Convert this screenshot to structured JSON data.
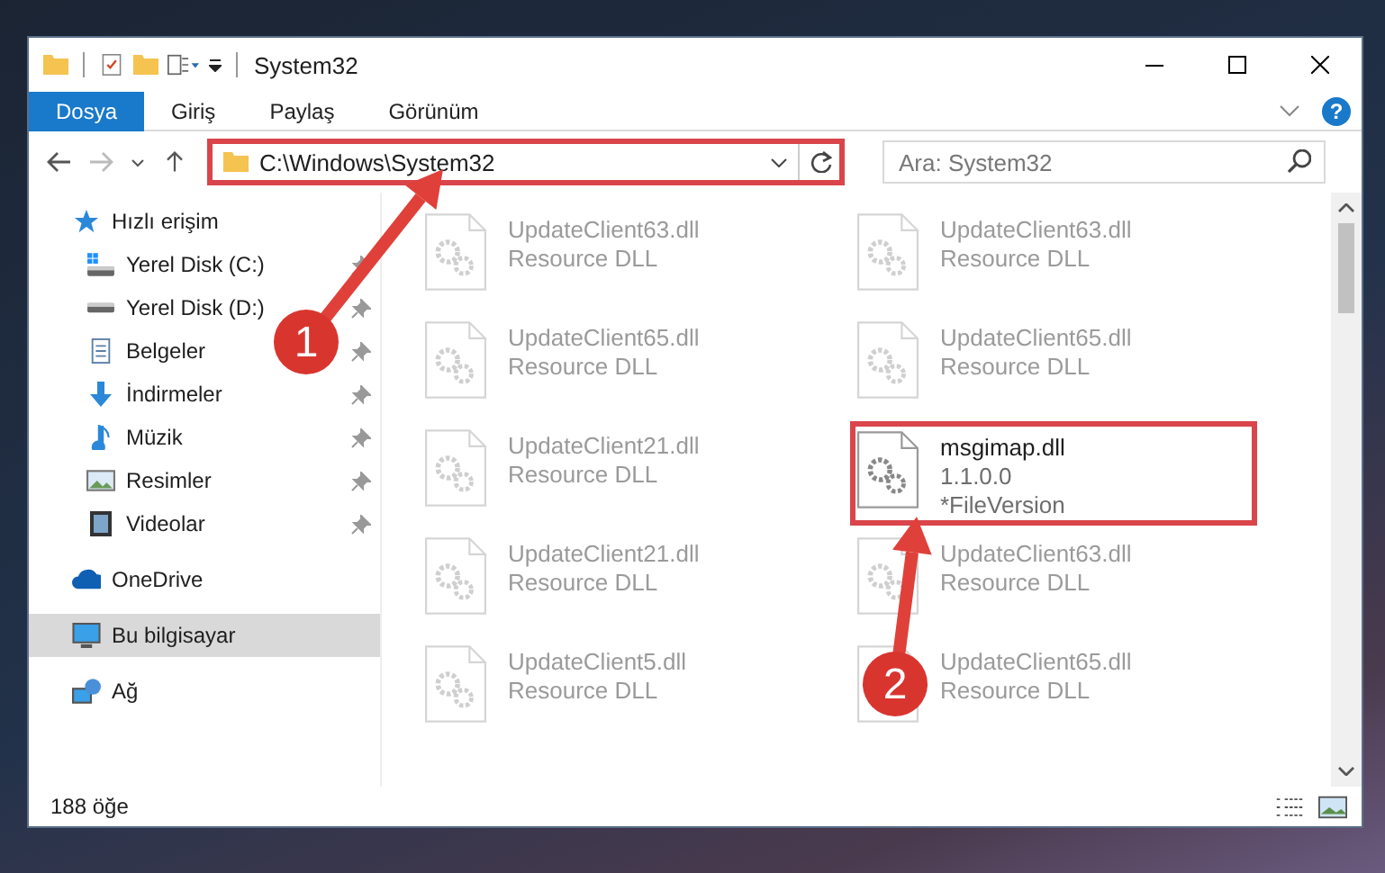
{
  "window": {
    "title": "System32"
  },
  "ribbon_tabs": [
    {
      "label": "Dosya",
      "selected": true
    },
    {
      "label": "Giriş",
      "selected": false
    },
    {
      "label": "Paylaş",
      "selected": false
    },
    {
      "label": "Görünüm",
      "selected": false
    }
  ],
  "help_button": {
    "label": "?"
  },
  "address_bar": {
    "path": "C:\\Windows\\System32",
    "highlighted": true
  },
  "search": {
    "placeholder": "Ara: System32"
  },
  "sidebar": {
    "items": [
      {
        "label": "Hızlı erişim",
        "selected": false,
        "children": [
          {
            "label": "Yerel Disk (C:)",
            "pinned": true,
            "selected": false
          },
          {
            "label": "Yerel Disk (D:)",
            "pinned": true,
            "selected": false
          },
          {
            "label": "Belgeler",
            "pinned": true,
            "selected": false
          },
          {
            "label": "İndirmeler",
            "pinned": true,
            "selected": false
          },
          {
            "label": "Müzik",
            "pinned": true,
            "selected": false
          },
          {
            "label": "Resimler",
            "pinned": true,
            "selected": false
          },
          {
            "label": "Videolar",
            "pinned": true,
            "selected": false
          }
        ]
      },
      {
        "label": "OneDrive",
        "selected": false
      },
      {
        "label": "Bu bilgisayar",
        "selected": true
      },
      {
        "label": "Ağ",
        "selected": false
      }
    ]
  },
  "files": [
    {
      "name": "UpdateClient63.dll",
      "line_2": "Resource DLL",
      "faded": true,
      "highlighted": false
    },
    {
      "name": "UpdateClient63.dll",
      "line_2": "Resource DLL",
      "faded": true,
      "highlighted": false
    },
    {
      "name": "UpdateClient65.dll",
      "line_2": "Resource DLL",
      "faded": true,
      "highlighted": false
    },
    {
      "name": "UpdateClient65.dll",
      "line_2": "Resource DLL",
      "faded": true,
      "highlighted": false
    },
    {
      "name": "UpdateClient21.dll",
      "line_2": "Resource DLL",
      "faded": true,
      "highlighted": false
    },
    {
      "name": "msgimap.dll",
      "line_2": "1.1.0.0",
      "line_3": "*FileVersion",
      "faded": false,
      "highlighted": true
    },
    {
      "name": "UpdateClient21.dll",
      "line_2": "Resource DLL",
      "faded": true,
      "highlighted": false
    },
    {
      "name": "UpdateClient63.dll",
      "line_2": "Resource DLL",
      "faded": true,
      "highlighted": false
    },
    {
      "name": "UpdateClient5.dll",
      "line_2": "Resource DLL",
      "faded": true,
      "highlighted": false
    },
    {
      "name": "UpdateClient65.dll",
      "line_2": "Resource DLL",
      "faded": true,
      "highlighted": false
    }
  ],
  "status_bar": {
    "item_count": "188 öğe"
  },
  "annotations": [
    {
      "label": "1"
    },
    {
      "label": "2"
    }
  ]
}
